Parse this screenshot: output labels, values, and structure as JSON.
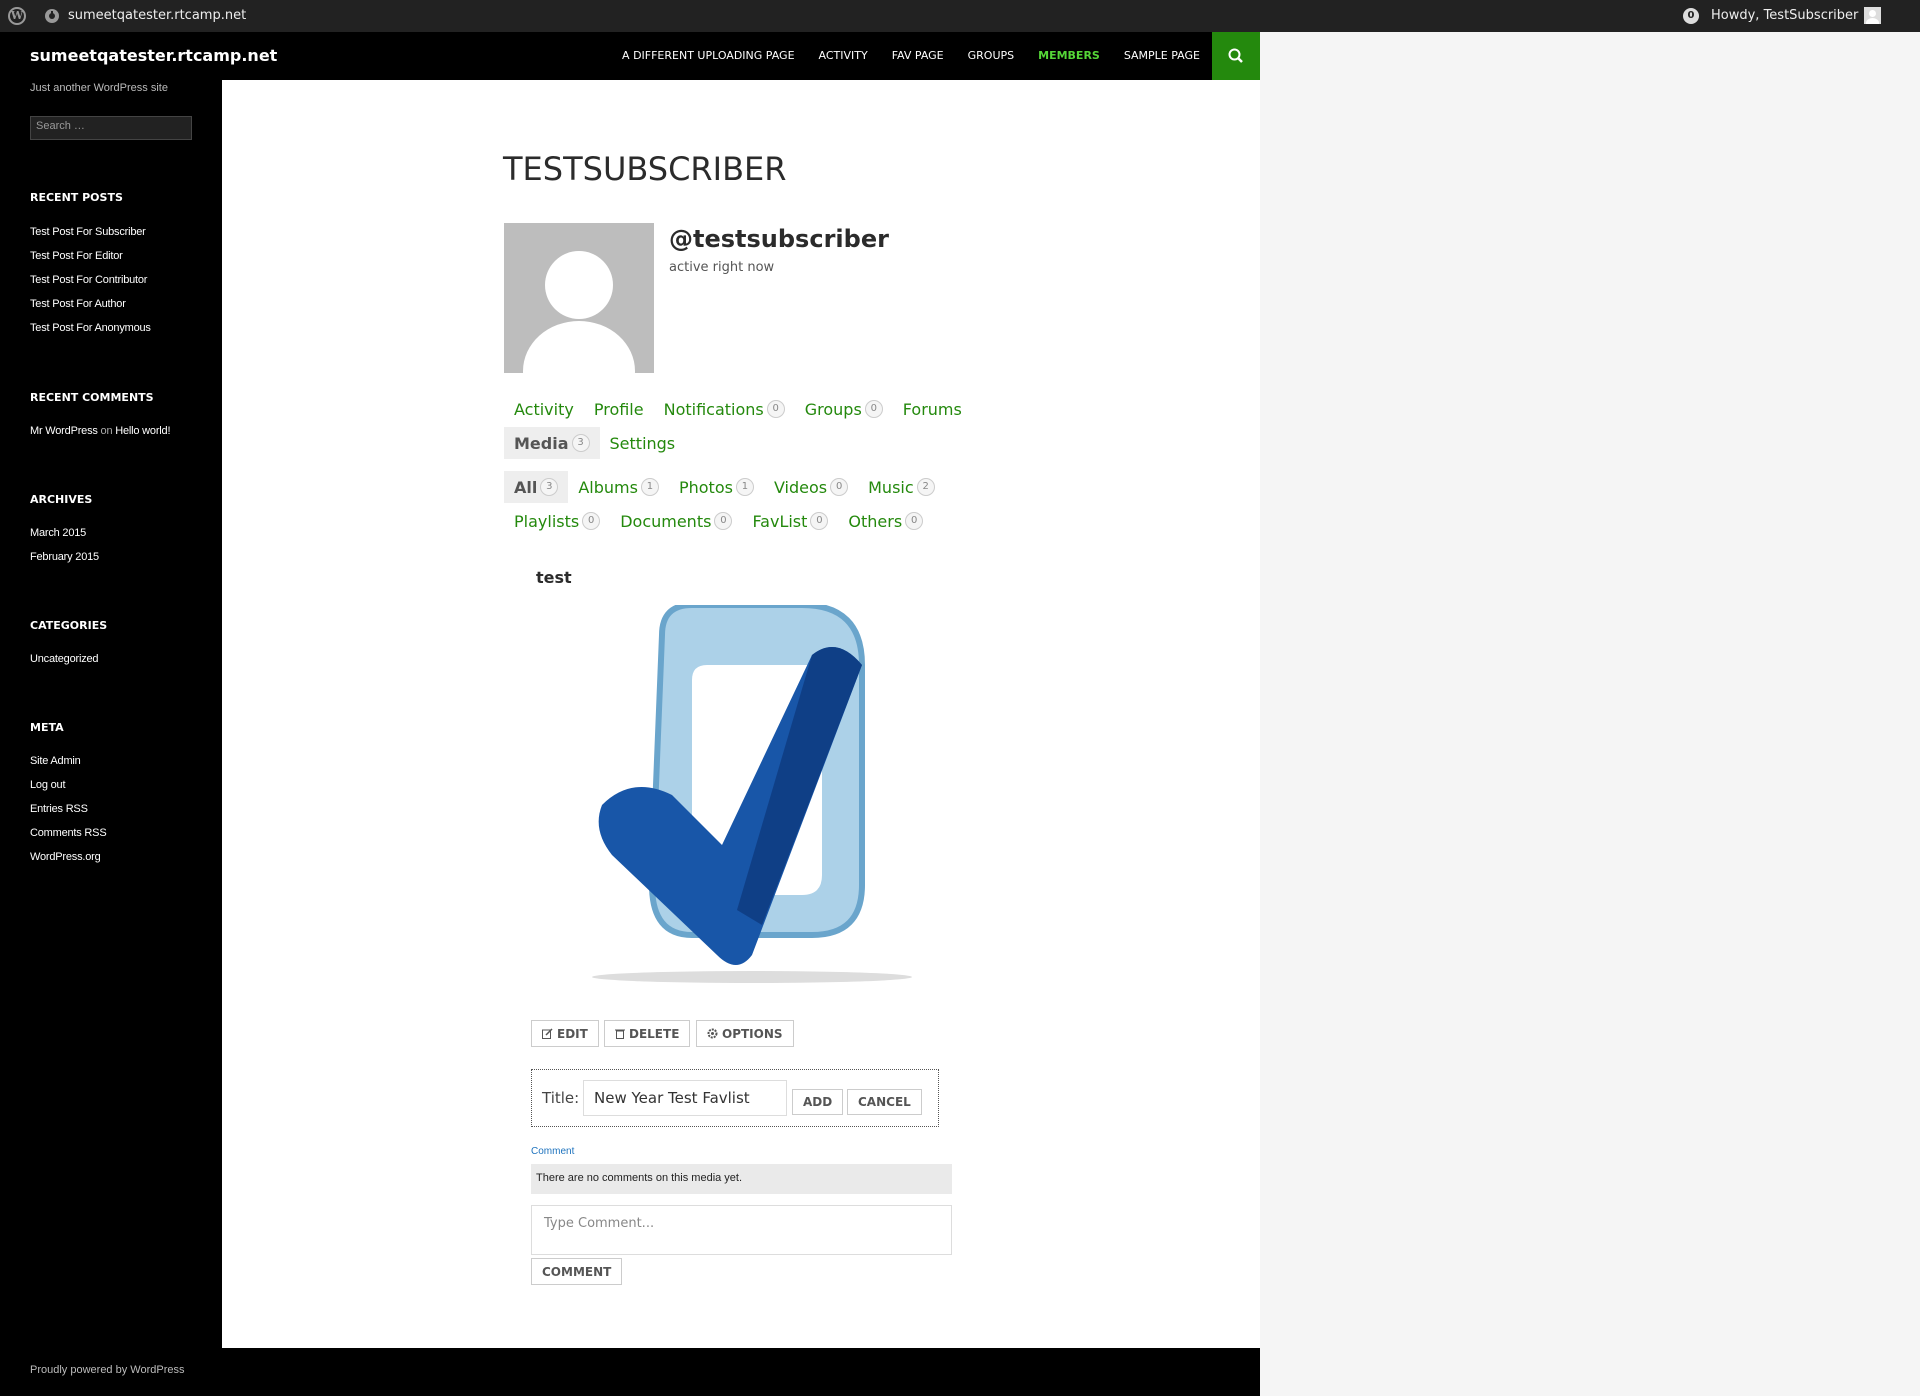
{
  "adminbar": {
    "site": "sumeetqatester.rtcamp.net",
    "notifications_count": "0",
    "howdy": "Howdy, TestSubscriber"
  },
  "header": {
    "site_title": "sumeetqatester.rtcamp.net",
    "nav": [
      "A DIFFERENT UPLOADING PAGE",
      "ACTIVITY",
      "FAV PAGE",
      "GROUPS",
      "MEMBERS",
      "SAMPLE PAGE"
    ],
    "active_nav": "MEMBERS"
  },
  "sidebar": {
    "tagline": "Just another WordPress site",
    "search_placeholder": "Search …",
    "recent_posts_title": "RECENT POSTS",
    "recent_posts": [
      "Test Post For Subscriber",
      "Test Post For Editor",
      "Test Post For Contributor",
      "Test Post For Author",
      "Test Post For Anonymous"
    ],
    "recent_comments_title": "RECENT COMMENTS",
    "recent_comment": {
      "author": "Mr WordPress",
      "on": "on",
      "post": "Hello world!"
    },
    "archives_title": "ARCHIVES",
    "archives": [
      "March 2015",
      "February 2015"
    ],
    "categories_title": "CATEGORIES",
    "categories": [
      "Uncategorized"
    ],
    "meta_title": "META",
    "meta": [
      "Site Admin",
      "Log out",
      "Entries RSS",
      "Comments RSS",
      "WordPress.org"
    ]
  },
  "profile": {
    "page_title": "TESTSUBSCRIBER",
    "username": "@testsubscriber",
    "status": "active right now",
    "nav": [
      {
        "label": "Activity",
        "count": null
      },
      {
        "label": "Profile",
        "count": null
      },
      {
        "label": "Notifications",
        "count": "0"
      },
      {
        "label": "Groups",
        "count": "0"
      },
      {
        "label": "Forums",
        "count": null
      }
    ],
    "nav2": [
      {
        "label": "Media",
        "count": "3",
        "current": true
      },
      {
        "label": "Settings",
        "count": null
      }
    ]
  },
  "media_nav": {
    "row1": [
      {
        "label": "All",
        "count": "3",
        "current": true
      },
      {
        "label": "Albums",
        "count": "1"
      },
      {
        "label": "Photos",
        "count": "1"
      },
      {
        "label": "Videos",
        "count": "0"
      },
      {
        "label": "Music",
        "count": "2"
      }
    ],
    "row2": [
      {
        "label": "Playlists",
        "count": "0"
      },
      {
        "label": "Documents",
        "count": "0"
      },
      {
        "label": "FavList",
        "count": "0"
      },
      {
        "label": "Others",
        "count": "0"
      }
    ]
  },
  "media": {
    "title": "test",
    "buttons": {
      "edit": "EDIT",
      "delete": "DELETE",
      "options": "OPTIONS"
    },
    "favlist_form": {
      "label": "Title:",
      "value": "New Year Test Favlist",
      "add": "ADD",
      "cancel": "CANCEL"
    },
    "comment_label": "Comment",
    "no_comments": "There are no comments on this media yet.",
    "comment_placeholder": "Type Comment...",
    "comment_button": "COMMENT"
  },
  "footer": {
    "text": "Proudly powered by WordPress"
  },
  "colors": {
    "accent": "#24890d",
    "active_nav": "#55d737",
    "header_bg": "#000000"
  }
}
